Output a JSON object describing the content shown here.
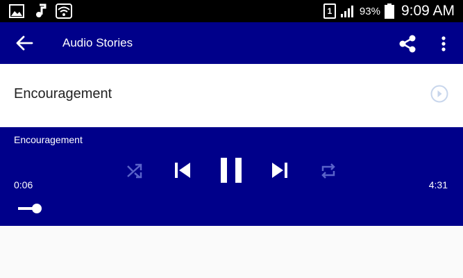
{
  "status_bar": {
    "sim_slot": "1",
    "battery": "93%",
    "time": "9:09 AM",
    "icons": [
      "image-icon",
      "music-note-icon",
      "wifi-icon",
      "sim-icon",
      "signal-icon",
      "battery-icon"
    ]
  },
  "app_bar": {
    "title": "Audio Stories",
    "icons": [
      "back-arrow-icon",
      "share-icon",
      "more-vert-icon"
    ],
    "color": "#00008a"
  },
  "list": {
    "items": [
      {
        "title": "Encouragement",
        "icon": "play-circle-icon"
      }
    ]
  },
  "player": {
    "track_title": "Encouragement",
    "current_time": "0:06",
    "total_time": "4:31",
    "progress": 0.022,
    "controls": [
      "shuffle-icon",
      "skip-previous-icon",
      "pause-icon",
      "skip-next-icon",
      "repeat-icon"
    ],
    "color": "#00008a"
  }
}
